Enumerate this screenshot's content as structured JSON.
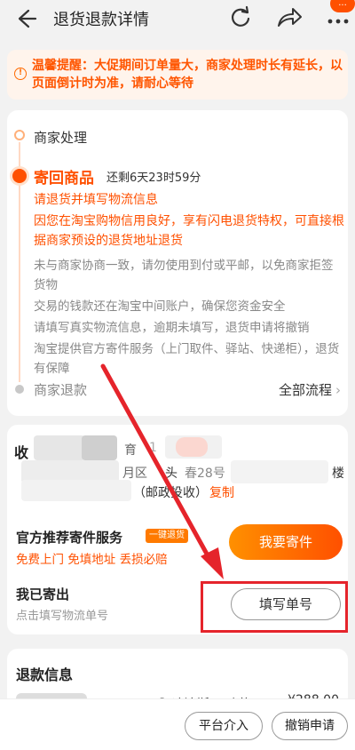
{
  "header": {
    "title": "退货退款详情",
    "badge": "..."
  },
  "notice": {
    "text": "温馨提醒：大促期间订单量大，商家处理时长有延长，以页面倒计时为准，请耐心等待"
  },
  "timeline": {
    "merchant_handle": "商家处理",
    "return_goods": "寄回商品",
    "countdown": "还剩6天23时59分",
    "fill_tip": "请退货并填写物流信息",
    "privilege": "因您在淘宝购物信用良好，享有闪电退货特权，可直接根据商家预设的退货地址退货",
    "gray_lines": [
      "未与商家协商一致，请勿使用到付或平邮，以免商家拒签货物",
      "交易的钱款还在淘宝中间账户，确保您资金安全",
      "请填写真实物流信息，逾期未填写，退货申请将撤销",
      "淘宝提供官方寄件服务（上门取件、驿站、快递柜），退货有保障"
    ],
    "merchant_refund": "商家退款",
    "all_process": "全部流程"
  },
  "address": {
    "label_fragment": "收",
    "name_fragment": "育",
    "phone_fragment": "1",
    "district_fragment": "月区",
    "street_fragment": "头",
    "street_fragment_2": "春28号",
    "building_fragment": "楼",
    "postal_note": "（邮政投收）",
    "copy": "复制"
  },
  "shipping": {
    "title": "官方推荐寄件服务",
    "badge": "一键退货",
    "perks": "免费上门 免填地址 丢损必赔",
    "ship_button": "我要寄件"
  },
  "sent": {
    "title": "我已寄出",
    "subtitle": "点击填写物流单号",
    "fill_button": "填写单号"
  },
  "refund": {
    "title": "退款信息",
    "product_name": "Adidas/阿迪达斯 三叶草",
    "price": "¥288.00"
  },
  "bottom": {
    "platform": "平台介入",
    "cancel": "撤销申请"
  },
  "colors": {
    "accent": "#ff5000",
    "annotation_red": "#e5242b"
  }
}
